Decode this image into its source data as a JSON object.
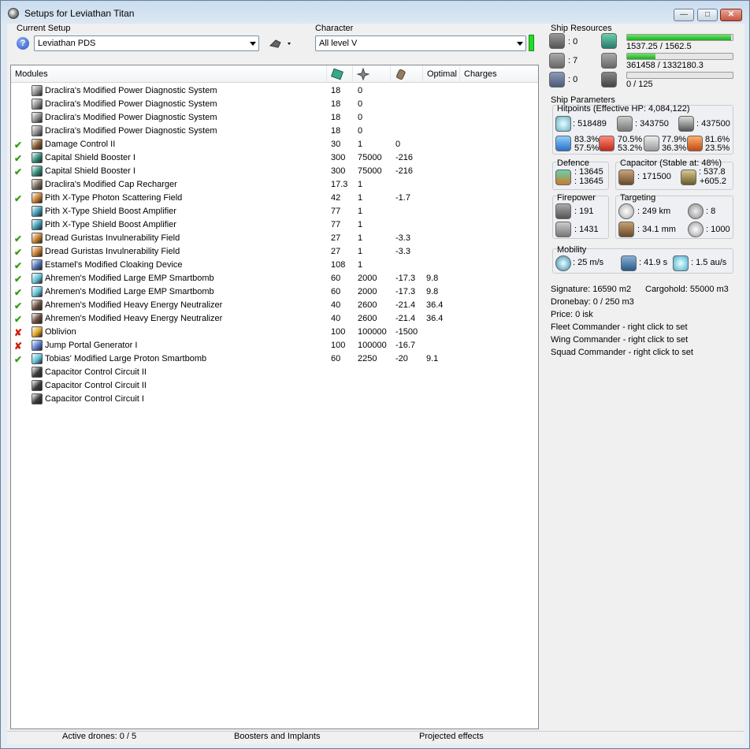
{
  "window": {
    "title": "Setups for Leviathan Titan",
    "minimize": "—",
    "maximize": "□",
    "close": "✕"
  },
  "setup": {
    "label": "Current Setup",
    "value": "Leviathan PDS",
    "help": "?"
  },
  "character": {
    "label": "Character",
    "value": "All level V"
  },
  "modules": {
    "headers": {
      "name": "Modules",
      "optimal": "Optimal",
      "charges": "Charges"
    },
    "rows": [
      {
        "status": "",
        "icon_color": "#8a8a8a",
        "name": "Draclira's Modified Power Diagnostic System",
        "c1": "18",
        "c2": "0",
        "c3": "",
        "optimal": "",
        "charges": ""
      },
      {
        "status": "",
        "icon_color": "#8a8a8a",
        "name": "Draclira's Modified Power Diagnostic System",
        "c1": "18",
        "c2": "0",
        "c3": "",
        "optimal": "",
        "charges": ""
      },
      {
        "status": "",
        "icon_color": "#8a8a8a",
        "name": "Draclira's Modified Power Diagnostic System",
        "c1": "18",
        "c2": "0",
        "c3": "",
        "optimal": "",
        "charges": ""
      },
      {
        "status": "",
        "icon_color": "#8a8a8a",
        "name": "Draclira's Modified Power Diagnostic System",
        "c1": "18",
        "c2": "0",
        "c3": "",
        "optimal": "",
        "charges": ""
      },
      {
        "status": "✔",
        "icon_color": "#8a5a2a",
        "name": "Damage Control II",
        "c1": "30",
        "c2": "1",
        "c3": "0",
        "optimal": "",
        "charges": ""
      },
      {
        "status": "✔",
        "icon_color": "#2f8c7a",
        "name": "Capital Shield Booster I",
        "c1": "300",
        "c2": "75000",
        "c3": "-216",
        "optimal": "",
        "charges": ""
      },
      {
        "status": "✔",
        "icon_color": "#2f8c7a",
        "name": "Capital Shield Booster I",
        "c1": "300",
        "c2": "75000",
        "c3": "-216",
        "optimal": "",
        "charges": ""
      },
      {
        "status": "",
        "icon_color": "#7a6a5a",
        "name": "Draclira's Modified Cap Recharger",
        "c1": "17.3",
        "c2": "1",
        "c3": "",
        "optimal": "",
        "charges": ""
      },
      {
        "status": "✔",
        "icon_color": "#c77b2a",
        "name": "Pith X-Type Photon Scattering Field",
        "c1": "42",
        "c2": "1",
        "c3": "-1.7",
        "optimal": "",
        "charges": ""
      },
      {
        "status": "",
        "icon_color": "#3a9bb5",
        "name": "Pith X-Type Shield Boost Amplifier",
        "c1": "77",
        "c2": "1",
        "c3": "",
        "optimal": "",
        "charges": ""
      },
      {
        "status": "",
        "icon_color": "#3a9bb5",
        "name": "Pith X-Type Shield Boost Amplifier",
        "c1": "77",
        "c2": "1",
        "c3": "",
        "optimal": "",
        "charges": ""
      },
      {
        "status": "✔",
        "icon_color": "#c77b2a",
        "name": "Dread Guristas Invulnerability Field",
        "c1": "27",
        "c2": "1",
        "c3": "-3.3",
        "optimal": "",
        "charges": ""
      },
      {
        "status": "✔",
        "icon_color": "#c77b2a",
        "name": "Dread Guristas Invulnerability Field",
        "c1": "27",
        "c2": "1",
        "c3": "-3.3",
        "optimal": "",
        "charges": ""
      },
      {
        "status": "✔",
        "icon_color": "#4a6fb0",
        "name": "Estamel's Modified Cloaking Device",
        "c1": "108",
        "c2": "1",
        "c3": "",
        "optimal": "",
        "charges": ""
      },
      {
        "status": "✔",
        "icon_color": "#5fc0d8",
        "name": "Ahremen's Modified Large EMP Smartbomb",
        "c1": "60",
        "c2": "2000",
        "c3": "-17.3",
        "optimal": "9.8",
        "charges": ""
      },
      {
        "status": "✔",
        "icon_color": "#5fc0d8",
        "name": "Ahremen's Modified Large EMP Smartbomb",
        "c1": "60",
        "c2": "2000",
        "c3": "-17.3",
        "optimal": "9.8",
        "charges": ""
      },
      {
        "status": "✔",
        "icon_color": "#6a4a3a",
        "name": "Ahremen's Modified Heavy Energy Neutralizer",
        "c1": "40",
        "c2": "2600",
        "c3": "-21.4",
        "optimal": "36.4",
        "charges": ""
      },
      {
        "status": "✔",
        "icon_color": "#6a4a3a",
        "name": "Ahremen's Modified Heavy Energy Neutralizer",
        "c1": "40",
        "c2": "2600",
        "c3": "-21.4",
        "optimal": "36.4",
        "charges": ""
      },
      {
        "status": "✘",
        "icon_color": "#e0a020",
        "name": "Oblivion",
        "c1": "100",
        "c2": "100000",
        "c3": "-1500",
        "optimal": "",
        "charges": ""
      },
      {
        "status": "✘",
        "icon_color": "#5a7ad0",
        "name": "Jump Portal Generator I",
        "c1": "100",
        "c2": "100000",
        "c3": "-16.7",
        "optimal": "",
        "charges": ""
      },
      {
        "status": "✔",
        "icon_color": "#5fc0d8",
        "name": "Tobias' Modified Large Proton Smartbomb",
        "c1": "60",
        "c2": "2250",
        "c3": "-20",
        "optimal": "9.1",
        "charges": ""
      },
      {
        "status": "",
        "icon_color": "#3a3a3a",
        "name": "Capacitor Control Circuit II",
        "c1": "",
        "c2": "",
        "c3": "",
        "optimal": "",
        "charges": ""
      },
      {
        "status": "",
        "icon_color": "#3a3a3a",
        "name": "Capacitor Control Circuit II",
        "c1": "",
        "c2": "",
        "c3": "",
        "optimal": "",
        "charges": ""
      },
      {
        "status": "",
        "icon_color": "#3a3a3a",
        "name": "Capacitor Control Circuit I",
        "c1": "",
        "c2": "",
        "c3": "",
        "optimal": "",
        "charges": ""
      }
    ]
  },
  "resources": {
    "title": "Ship Resources",
    "turrets": ": 0",
    "launchers": ": 7",
    "calibration": ": 0",
    "cpu": {
      "text": "1537.25 / 1562.5",
      "fraction": 0.984
    },
    "powergrid": {
      "text": "361458 / 1332180.3",
      "fraction": 0.271
    },
    "drone_bandwidth": {
      "text": "0 / 125",
      "fraction": 0
    }
  },
  "params": {
    "title": "Ship Parameters",
    "hitpoints": {
      "title": "Hitpoints (Effective HP: 4,084,122)",
      "shield": ": 518489",
      "armor": ": 343750",
      "structure": ": 437500",
      "em": {
        "shield": "83.3%",
        "armor": "57.5%"
      },
      "thermal": {
        "shield": "70.5%",
        "armor": "53.2%"
      },
      "kinetic": {
        "shield": "77.9%",
        "armor": "36.3%"
      },
      "explosive": {
        "shield": "81.6%",
        "armor": "23.5%"
      }
    },
    "defence": {
      "title": "Defence",
      "v1": ": 13645",
      "v2": ": 13645"
    },
    "capacitor": {
      "title": "Capacitor (Stable at: 48%)",
      "capacity": ": 171500",
      "rate": ": 537.8",
      "delta": "+605.2"
    },
    "firepower": {
      "title": "Firepower",
      "v1": ": 191",
      "v2": ": 1431"
    },
    "targeting": {
      "title": "Targeting",
      "range": ": 249 km",
      "targets": ": 8",
      "scan": ": 34.1 mm",
      "sig": ": 1000"
    },
    "mobility": {
      "title": "Mobility",
      "speed": ": 25 m/s",
      "align": ": 41.9 s",
      "warp": ": 1.5 au/s"
    }
  },
  "info": {
    "signature": "Signature: 16590 m2",
    "cargohold": "Cargohold: 55000 m3",
    "dronebay": "Dronebay: 0 / 250 m3",
    "price": "Price: 0 isk",
    "fleet": "Fleet Commander - right click to set",
    "wing": "Wing Commander - right click to set",
    "squad": "Squad Commander - right click to set"
  },
  "bottom": {
    "drones": "Active drones: 0 / 5",
    "boosters": "Boosters and Implants",
    "projected": "Projected effects"
  }
}
